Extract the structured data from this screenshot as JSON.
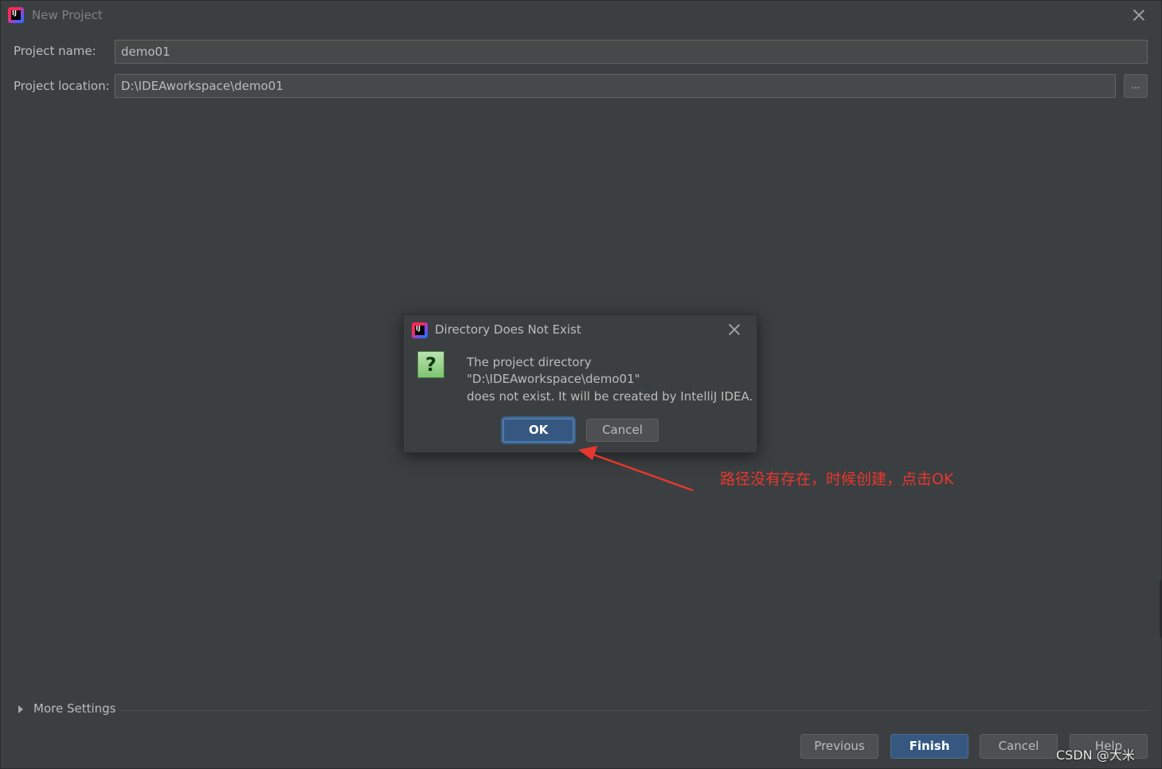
{
  "window": {
    "title": "New Project"
  },
  "form": {
    "name_label": "Project name:",
    "name_value": "demo01",
    "location_label": "Project location:",
    "location_value": "D:\\IDEAworkspace\\demo01",
    "browse_label": "..."
  },
  "more_settings": {
    "label": "More Settings"
  },
  "footer": {
    "previous": "Previous",
    "finish": "Finish",
    "cancel": "Cancel",
    "help": "Help"
  },
  "dialog": {
    "title": "Directory Does Not Exist",
    "icon": "question-icon",
    "message_lines": [
      "The project directory",
      "\"D:\\IDEAworkspace\\demo01\"",
      "does not exist. It will be created by IntelliJ IDEA."
    ],
    "ok": "OK",
    "cancel": "Cancel"
  },
  "annotation": {
    "text": "路径没有存在，时候创建，点击OK",
    "color": "#e8372e"
  },
  "watermark": {
    "text": "CSDN @大米"
  },
  "colors": {
    "background": "#3c3f41",
    "field": "#45494a",
    "primary_button": "#365880"
  }
}
